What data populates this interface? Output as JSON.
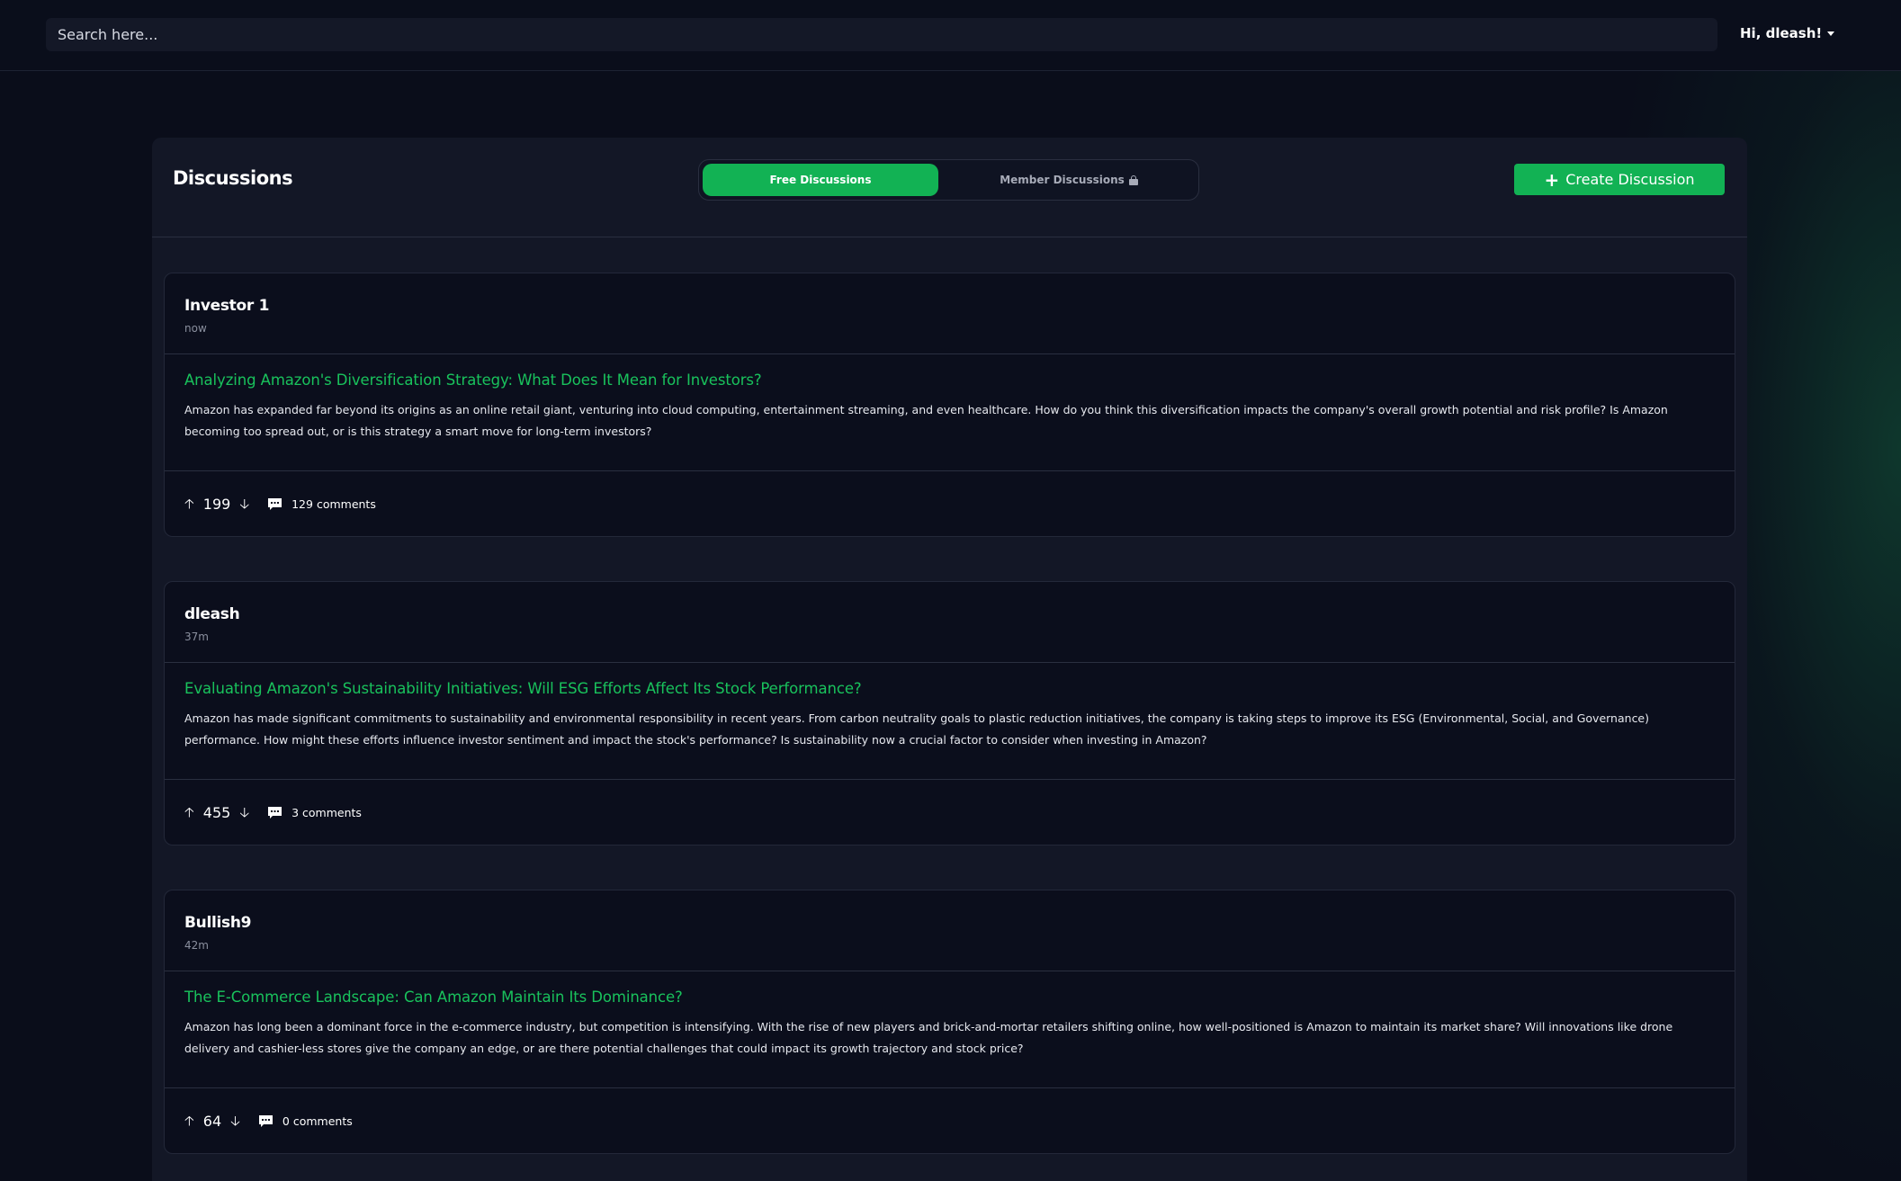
{
  "search": {
    "placeholder": "Search here..."
  },
  "user_menu": {
    "label": "Hi, dleash!"
  },
  "panel": {
    "title": "Discussions",
    "tabs": [
      {
        "label": "Free Discussions",
        "active": true
      },
      {
        "label": "Member Discussions",
        "active": false,
        "icon": "lock-icon"
      }
    ],
    "create_button_label": "Create Discussion"
  },
  "colors": {
    "accent": "#12b254",
    "title_green": "#19c25c",
    "background": "#0a0d1a",
    "panel": "#131726"
  },
  "discussions": [
    {
      "author": "Investor 1",
      "time": "now",
      "title": "Analyzing Amazon's Diversification Strategy: What Does It Mean for Investors?",
      "body": "Amazon has expanded far beyond its origins as an online retail giant, venturing into cloud computing, entertainment streaming, and even healthcare. How do you think this diversification impacts the company's overall growth potential and risk profile? Is Amazon becoming too spread out, or is this strategy a smart move for long-term investors?",
      "votes": "199",
      "comments": "129 comments"
    },
    {
      "author": "dleash",
      "time": "37m",
      "title": "Evaluating Amazon's Sustainability Initiatives: Will ESG Efforts Affect Its Stock Performance?",
      "body": "Amazon has made significant commitments to sustainability and environmental responsibility in recent years. From carbon neutrality goals to plastic reduction initiatives, the company is taking steps to improve its ESG (Environmental, Social, and Governance) performance. How might these efforts influence investor sentiment and impact the stock's performance? Is sustainability now a crucial factor to consider when investing in Amazon?",
      "votes": "455",
      "comments": "3 comments"
    },
    {
      "author": "Bullish9",
      "time": "42m",
      "title": "The E-Commerce Landscape: Can Amazon Maintain Its Dominance?",
      "body": "Amazon has long been a dominant force in the e-commerce industry, but competition is intensifying. With the rise of new players and brick-and-mortar retailers shifting online, how well-positioned is Amazon to maintain its market share? Will innovations like drone delivery and cashier-less stores give the company an edge, or are there potential challenges that could impact its growth trajectory and stock price?",
      "votes": "64",
      "comments": "0 comments"
    }
  ]
}
